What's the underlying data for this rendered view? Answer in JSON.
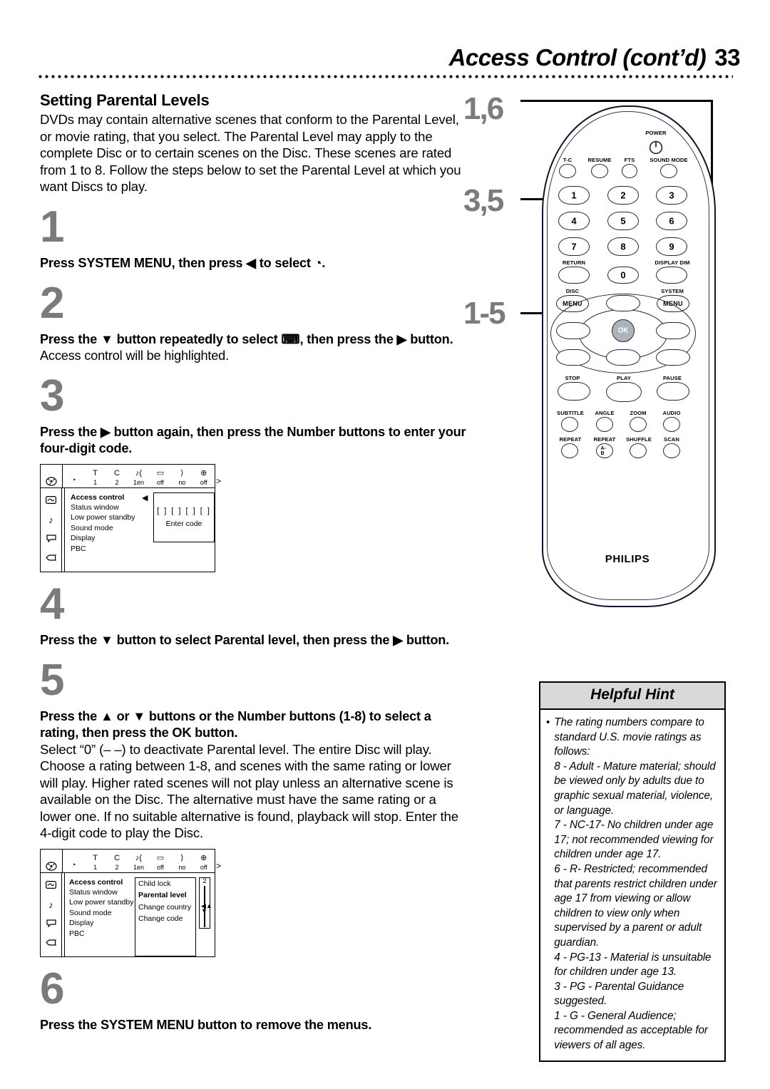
{
  "header": {
    "title": "Access Control (cont’d)",
    "page_number": "33"
  },
  "section": {
    "heading": "Setting Parental Levels",
    "intro": "DVDs may contain alternative scenes that conform to the Parental Level, or movie rating, that you select. The Parental Level may apply to the complete Disc or to certain scenes on the Disc. These scenes are rated from 1 to 8. Follow the steps below to set the Parental Level at which you want Discs to play."
  },
  "steps": [
    {
      "num": "1",
      "bold": "Press SYSTEM MENU, then press ◀ to select ◔.",
      "normal": ""
    },
    {
      "num": "2",
      "bold": "Press the ▼ button repeatedly to select ⌨, then press the ▶ button.",
      "normal": " Access control will be highlighted."
    },
    {
      "num": "3",
      "bold": "Press the ▶ button again, then press the Number buttons to enter your four-digit code.",
      "normal": ""
    },
    {
      "num": "4",
      "bold": "Press the ▼ button to select Parental level, then press the ▶ button.",
      "normal": ""
    },
    {
      "num": "5",
      "bold": "Press the ▲ or ▼ buttons or the Number buttons (1-8) to select a rating, then press the OK button.",
      "normal": ""
    },
    {
      "num": "6",
      "bold": "Press the SYSTEM MENU button to remove the menus.",
      "normal": ""
    }
  ],
  "step5_detail": "Select “0” (– –) to deactivate Parental level. The entire Disc will play. Choose a rating between 1-8, and scenes with the same rating or lower will play. Higher rated scenes will not play unless an alternative scene is available on the Disc. The alternative must have the same rating or a lower one. If no suitable alternative is found, playback will stop. Enter the 4-digit code to play the Disc.",
  "osd1": {
    "status_icons": [
      "disc-icon",
      "title-icon",
      "chapter-icon",
      "audio-language-icon",
      "subtitle-icon",
      "angle-icon",
      "zoom-icon"
    ],
    "status_glyphs": [
      "◔",
      "T",
      "C",
      "♪(",
      "▭",
      "⟩",
      "⊕"
    ],
    "status_values": [
      "",
      "1",
      "2",
      "1en",
      "off",
      "no",
      "off"
    ],
    "side_icons": [
      "picture-icon",
      "sound-icon",
      "language-icon",
      "features-icon"
    ],
    "side_glyphs": [
      "⬜",
      "♪",
      "⬜",
      "⌨"
    ],
    "menu_items": [
      "Access control",
      "Status window",
      "Low power standby",
      "Sound mode",
      "Display",
      "PBC"
    ],
    "selected_item": "Access control",
    "code_boxes": "[ ] [ ] [ ] [ ]",
    "code_label": "Enter code"
  },
  "osd2": {
    "status_glyphs": [
      "◔",
      "T",
      "C",
      "♪(",
      "▭",
      "⟩",
      "⊕"
    ],
    "status_values": [
      "",
      "1",
      "2",
      "1en",
      "off",
      "no",
      "off"
    ],
    "menu_items": [
      "Access control",
      "Status window",
      "Low power standby",
      "Sound mode",
      "Display",
      "PBC"
    ],
    "selected_item": "Access control",
    "sub_items": [
      "Child lock",
      "Parental level",
      "Change country",
      "Change code"
    ],
    "sub_selected": "Parental level",
    "slider_value": "2"
  },
  "remote": {
    "brand": "PHILIPS",
    "callouts": [
      {
        "label": "1,6",
        "target": "system-menu-button"
      },
      {
        "label": "3,5",
        "target": "number-buttons"
      },
      {
        "label": "1-5",
        "target": "cursor-and-ok-buttons"
      }
    ],
    "power_label": "POWER",
    "top_row": [
      "T-C",
      "RESUME",
      "FTS",
      "SOUND MODE"
    ],
    "numbers": [
      "1",
      "2",
      "3",
      "4",
      "5",
      "6",
      "7",
      "8",
      "9",
      "0"
    ],
    "return_label": "RETURN",
    "display_dim_label": "DISPLAY DIM",
    "disc_menu_label": "DISC",
    "system_menu_label": "SYSTEM",
    "menu_btn_label": "MENU",
    "ok_label": "OK",
    "transport": [
      "STOP",
      "PLAY",
      "PAUSE"
    ],
    "feature_row1": [
      "SUBTITLE",
      "ANGLE",
      "ZOOM",
      "AUDIO"
    ],
    "feature_row2": [
      "REPEAT",
      "REPEAT",
      "SHUFFLE",
      "SCAN"
    ],
    "repeat_ab_label": "A-B"
  },
  "hint": {
    "title": "Helpful Hint",
    "bullet": "•",
    "text": "The rating numbers compare to standard U.S. movie ratings as follows:\n8 - Adult - Mature material; should be viewed only by adults due to graphic sexual material, violence, or language.\n7 - NC-17- No children under age 17; not recommended viewing for children under age 17.\n6 - R- Restricted; recommended that parents restrict children under age 17 from viewing or allow children to view only when supervised by a parent or adult guardian.\n4 - PG-13 - Material is unsuitable for children under age 13.\n3 - PG - Parental Guidance suggested.\n1 - G - General Audience; recommended as acceptable for viewers of all ages."
  }
}
